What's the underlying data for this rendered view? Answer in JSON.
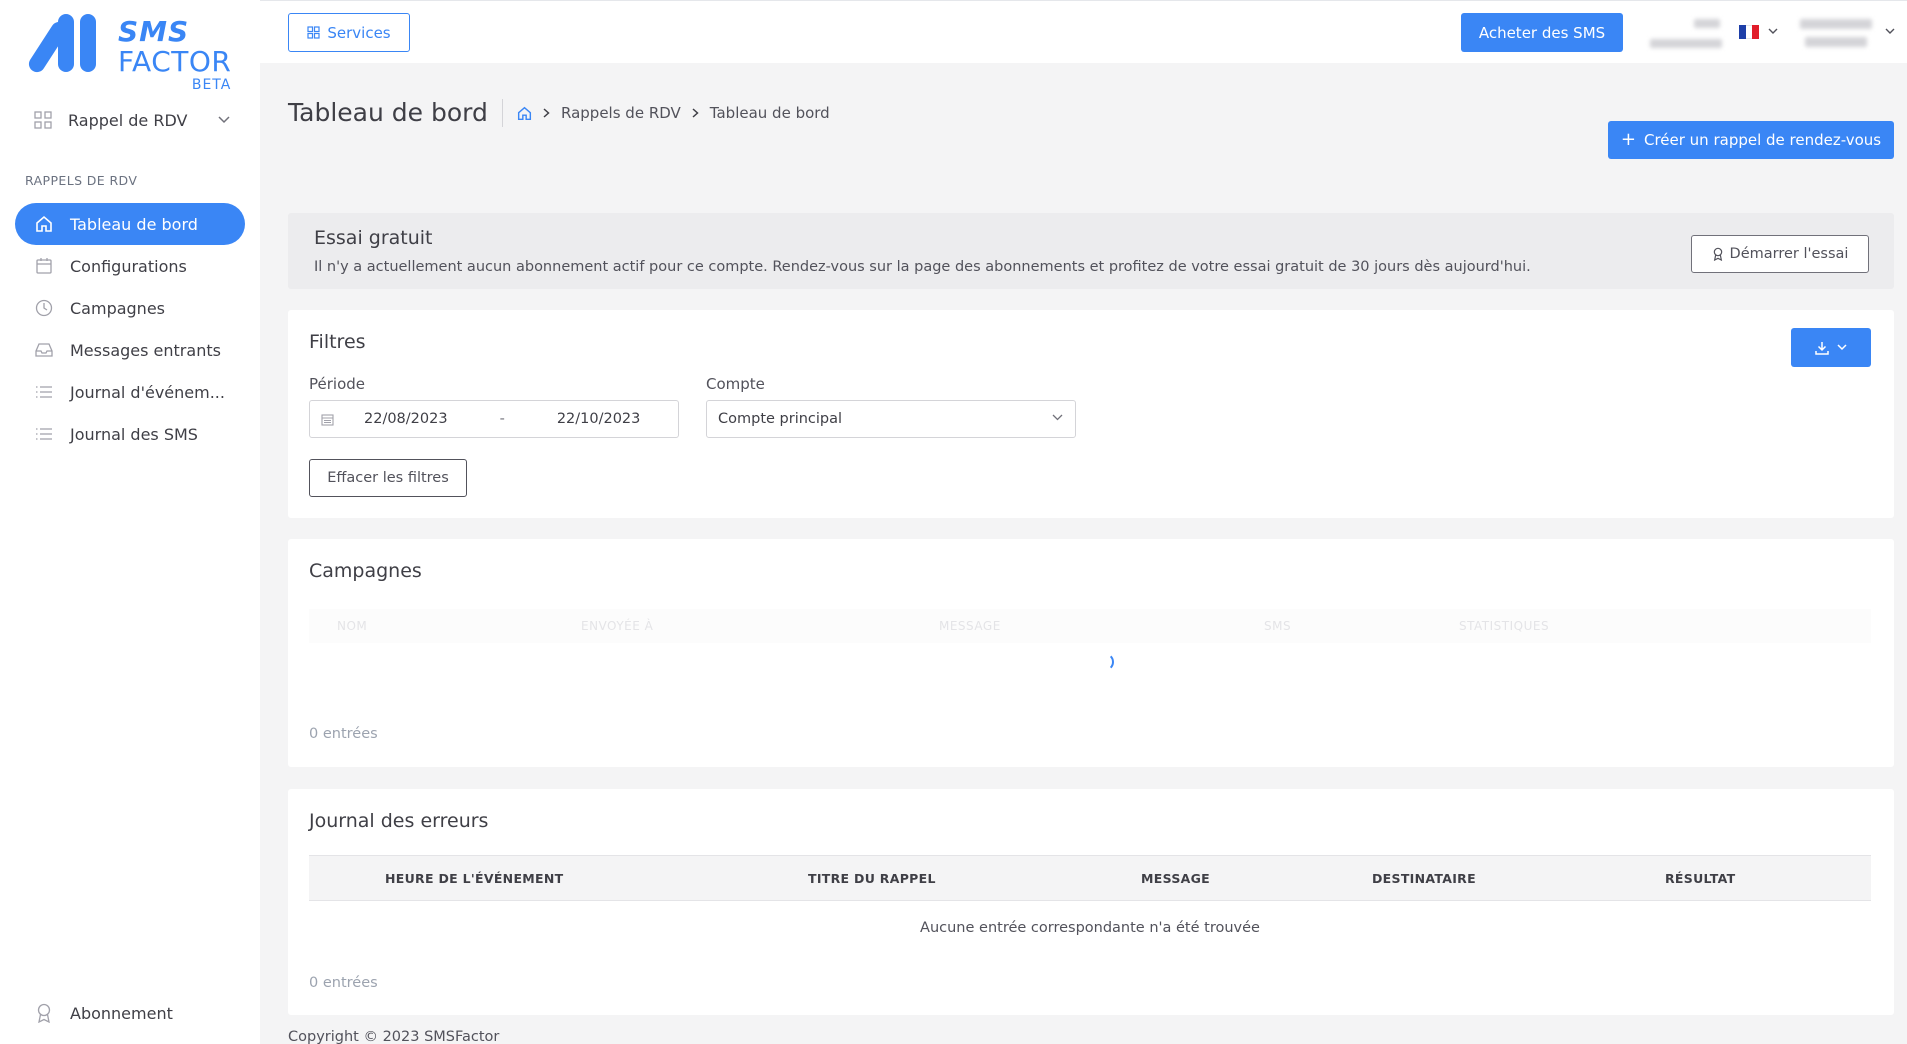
{
  "brand": {
    "line1": "SMS",
    "line2": "FACTOR",
    "tag": "BETA",
    "accent": "#3a86f5"
  },
  "sidebar": {
    "module_label": "Rappel de RDV",
    "section_title": "RAPPELS DE RDV",
    "items": [
      {
        "label": "Tableau de bord",
        "icon": "home-icon",
        "active": true
      },
      {
        "label": "Configurations",
        "icon": "calendar-icon",
        "active": false
      },
      {
        "label": "Campagnes",
        "icon": "clock-icon",
        "active": false
      },
      {
        "label": "Messages entrants",
        "icon": "inbox-icon",
        "active": false
      },
      {
        "label": "Journal d'événem...",
        "icon": "list-icon",
        "active": false
      },
      {
        "label": "Journal des SMS",
        "icon": "list-icon",
        "active": false
      }
    ],
    "bottom_item": "Abonnement"
  },
  "topbar": {
    "services_label": "Services",
    "buy_label": "Acheter des SMS",
    "language": "FR"
  },
  "page": {
    "title": "Tableau de bord",
    "breadcrumb": [
      "Rappels de RDV",
      "Tableau de bord"
    ],
    "create_label": "Créer un rappel de rendez-vous"
  },
  "trial": {
    "title": "Essai gratuit",
    "text": "Il n'y a actuellement aucun abonnement actif pour ce compte. Rendez-vous sur la page des abonnements et profitez de votre essai gratuit de 30 jours dès aujourd'hui.",
    "button": "Démarrer l'essai"
  },
  "filters": {
    "title": "Filtres",
    "period_label": "Période",
    "date_from": "22/08/2023",
    "date_sep": "-",
    "date_to": "22/10/2023",
    "account_label": "Compte",
    "account_value": "Compte principal",
    "clear_label": "Effacer les filtres"
  },
  "campaigns": {
    "title": "Campagnes",
    "columns": [
      "NOM",
      "ENVOYÉE À",
      "MESSAGE",
      "SMS",
      "STATISTIQUES"
    ],
    "entries": "0 entrées"
  },
  "errors": {
    "title": "Journal des erreurs",
    "columns": [
      "HEURE DE L'ÉVÉNEMENT",
      "TITRE DU RAPPEL",
      "MESSAGE",
      "DESTINATAIRE",
      "RÉSULTAT"
    ],
    "empty": "Aucune entrée correspondante n'a été trouvée",
    "entries": "0 entrées"
  },
  "footer": {
    "copyright": "Copyright © 2023 SMSFactor"
  }
}
